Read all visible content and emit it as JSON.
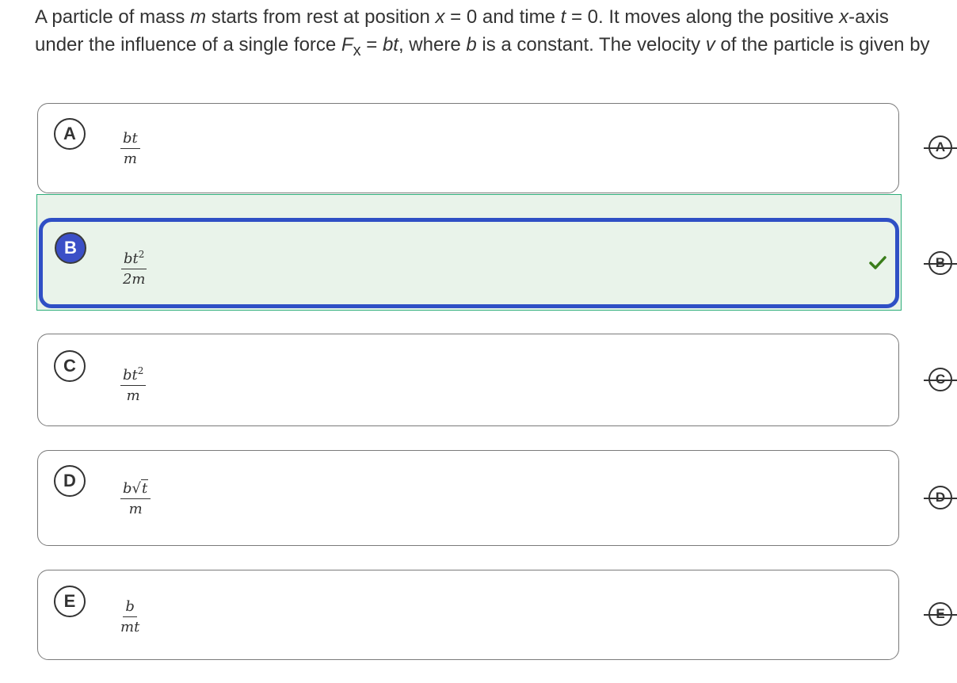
{
  "question": {
    "line1_a": "A particle of mass ",
    "line1_m": "m",
    "line1_b": " starts from rest at position ",
    "line1_x": "x",
    "line1_c": " = 0 and time ",
    "line1_t": "t",
    "line1_d": " = 0. It moves along the positive ",
    "line1_xaxis": "x",
    "line1_e": "-axis",
    "line2_a": "under the influence of a single force ",
    "line2_F": "F",
    "line2_sub": "x",
    "line2_b": " = ",
    "line2_bt": "bt",
    "line2_c": ", where ",
    "line2_bb": "b",
    "line2_d": " is a constant. The velocity ",
    "line2_v": "v",
    "line2_e": " of the particle is given by"
  },
  "choices": [
    {
      "letter": "A",
      "num": "bt",
      "num_sup": "",
      "den": "m"
    },
    {
      "letter": "B",
      "num": "bt",
      "num_sup": "2",
      "den": "2m"
    },
    {
      "letter": "C",
      "num": "bt",
      "num_sup": "2",
      "den": "m"
    },
    {
      "letter": "D",
      "num_pre": "b",
      "num_rad": "t",
      "den": "m"
    },
    {
      "letter": "E",
      "num": "b",
      "num_sup": "",
      "den": "mt"
    }
  ],
  "selected": "B",
  "colors": {
    "selected_accent": "#2f4fc5",
    "correct_bg": "#e9f3ea",
    "check": "#3a7d1a"
  }
}
